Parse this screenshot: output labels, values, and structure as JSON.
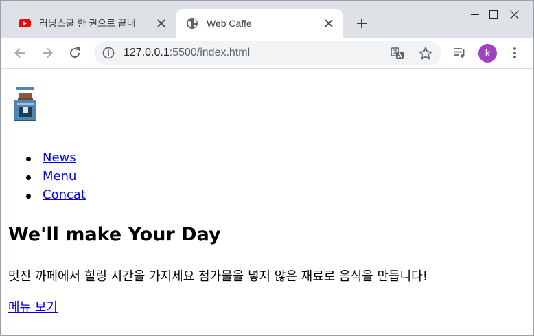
{
  "browser": {
    "tabs": [
      {
        "title": "러닝스쿨 한 권으로 끝내",
        "favicon": "youtube-icon",
        "active": false
      },
      {
        "title": "Web Caffe",
        "favicon": "globe-icon",
        "active": true
      }
    ],
    "address": {
      "host": "127.0.0.1",
      "path": ":5500/index.html"
    },
    "profile_initial": "k",
    "colors": {
      "tabstrip": "#dee1e6",
      "avatar": "#a142c5",
      "link": "#0000ee"
    }
  },
  "page": {
    "logo": "coffee-machine-icon",
    "nav": [
      {
        "label": "News"
      },
      {
        "label": "Menu"
      },
      {
        "label": "Concat"
      }
    ],
    "headline": "We'll make Your Day",
    "description": "멋진 까페에서 힐링 시간을 가지세요 첨가물을 넣지 않은 재료로 음식을 만듭니다!",
    "cta": "메뉴 보기"
  }
}
